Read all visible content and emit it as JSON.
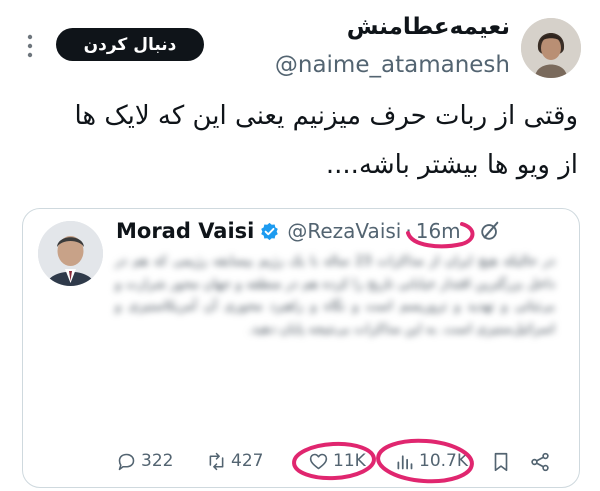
{
  "tweet": {
    "author_name": "نعیمه‌عطامنش",
    "author_handle": "@naime_atamanesh",
    "follow_label": "دنبال کردن",
    "text_line1": "وقتی از ربات حرف میزنیم یعنی این که لایک ها",
    "text_line2": "از ویو ها بیشتر باشه...."
  },
  "quoted_tweet": {
    "author_name": "Morad Vaisi",
    "author_handle": "@RezaVaisi",
    "separator": "·",
    "time": "16m",
    "body_blurred": "در حالیکه هیچ ایران از مذاکرات 23 ساله با یک رژیم بیسابقه رژیمی که هم در داخل بزرگترین اقتدار خیابانی تاریخ را کرده هم در منطقه و جهان محور شرارت و بی‌ثباتی و تهدید و تروریسم است و نگاه و راهبرد محوری آن آمریکاستیزی و اسرائیل‌ستیزی است. به این مذاکرات بی‌نتیجه پایان دهید.",
    "stats": {
      "replies": "322",
      "reposts": "427",
      "likes": "11K",
      "views": "10.7K"
    }
  },
  "colors": {
    "follow_button": "#0f1419",
    "verified_badge": "#1d9bf0",
    "annotation_marker": "#e0266f",
    "secondary_text": "#536471"
  },
  "icons": [
    "more-vertical-icon",
    "verified-badge-icon",
    "grok-icon",
    "reply-icon",
    "repost-icon",
    "like-heart-icon",
    "views-chart-icon",
    "bookmark-icon",
    "share-icon"
  ]
}
